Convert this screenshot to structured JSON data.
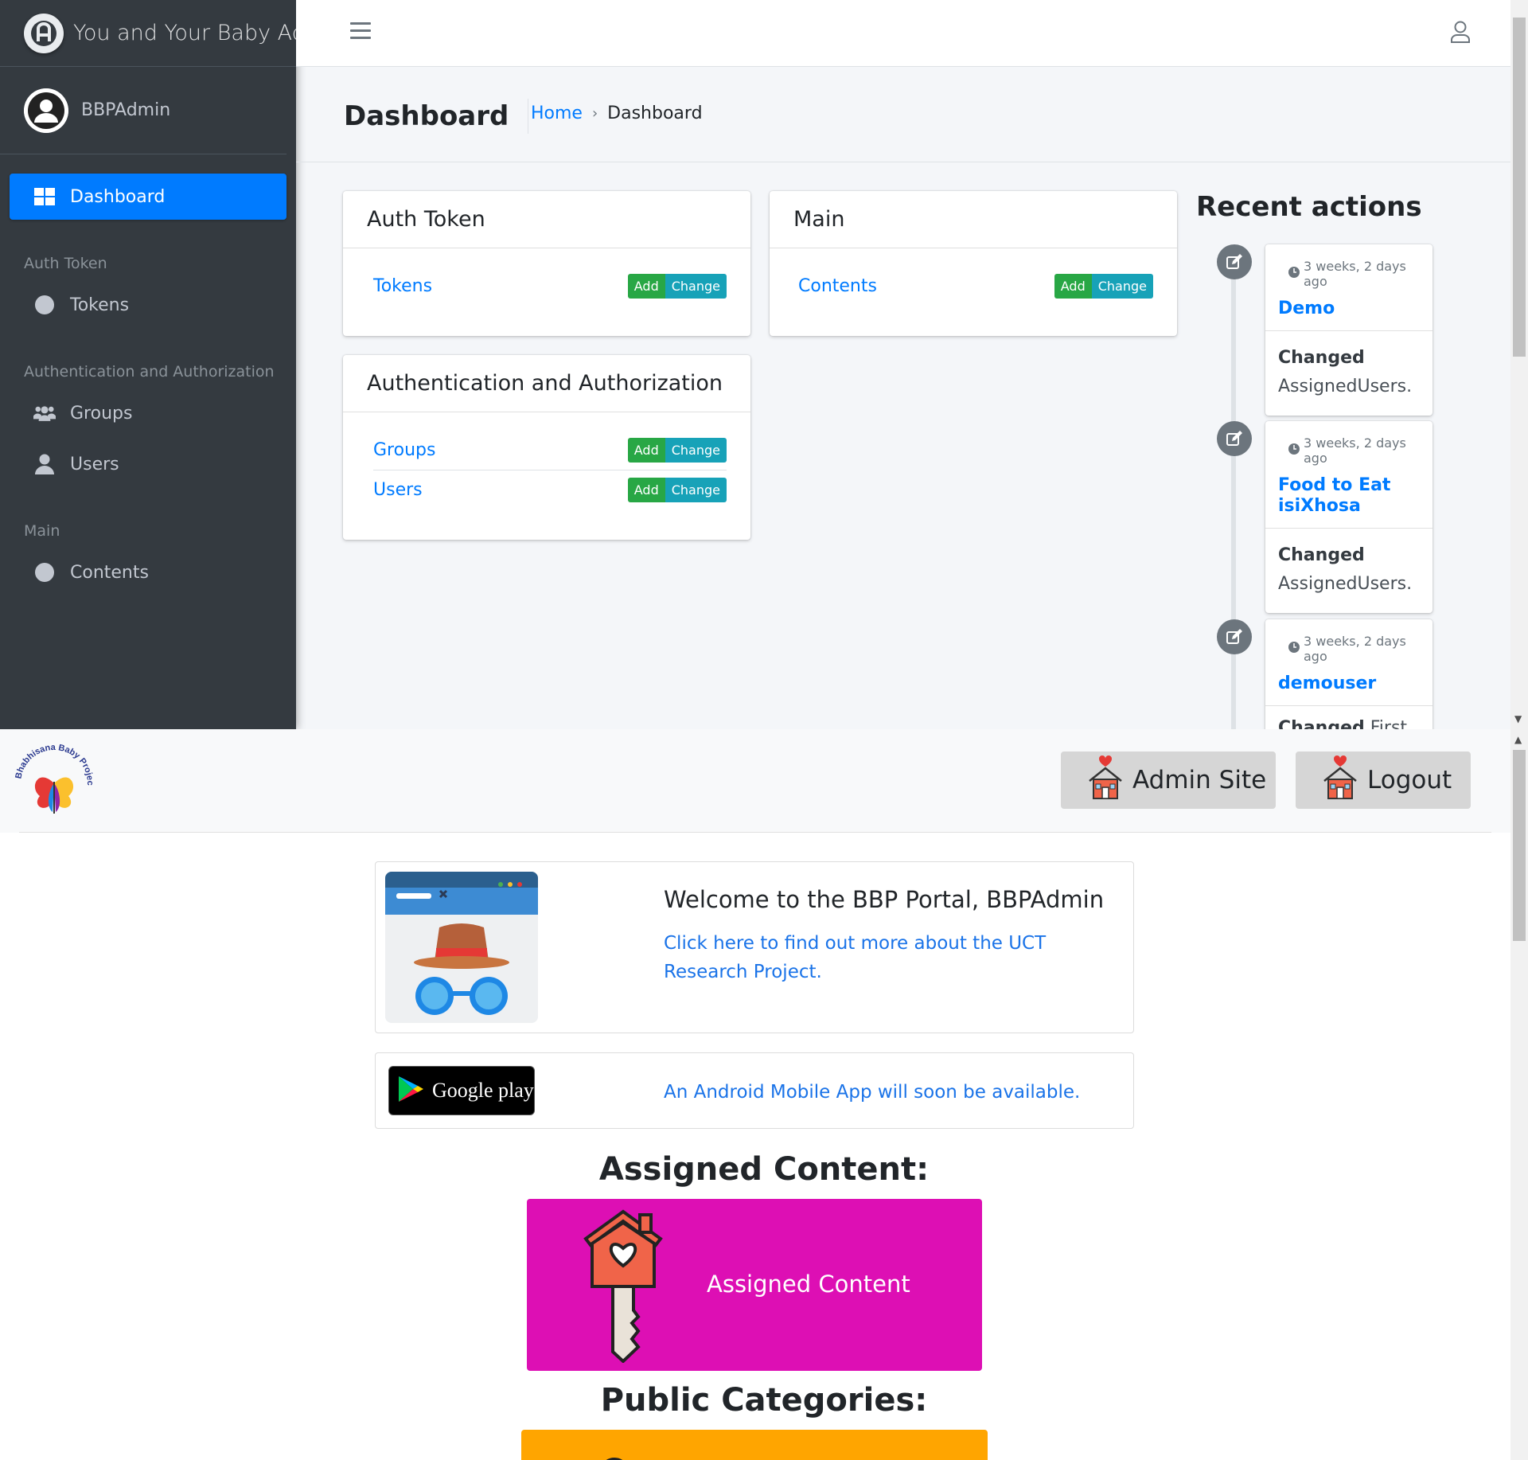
{
  "admin": {
    "brand": {
      "title": "You and Your Baby Admin"
    },
    "user": {
      "name": "BBPAdmin"
    },
    "sidebar": {
      "items": [
        {
          "label": "Dashboard",
          "icon": "dashboard-grid-icon",
          "active": true
        }
      ],
      "sections": [
        {
          "header": "Auth Token",
          "items": [
            {
              "label": "Tokens",
              "icon": "circle-icon"
            }
          ]
        },
        {
          "header": "Authentication and Authorization",
          "items": [
            {
              "label": "Groups",
              "icon": "users-group-icon"
            },
            {
              "label": "Users",
              "icon": "user-icon"
            }
          ]
        },
        {
          "header": "Main",
          "items": [
            {
              "label": "Contents",
              "icon": "circle-icon"
            }
          ]
        }
      ]
    },
    "header": {
      "page_title": "Dashboard",
      "breadcrumb": {
        "home": "Home",
        "separator": "›",
        "current": "Dashboard"
      }
    },
    "buttons": {
      "add": "Add",
      "change": "Change"
    },
    "cards": {
      "auth_token": {
        "title": "Auth Token",
        "rows": [
          "Tokens"
        ]
      },
      "main": {
        "title": "Main",
        "rows": [
          "Contents"
        ]
      },
      "auth": {
        "title": "Authentication and Authorization",
        "rows": [
          "Groups",
          "Users"
        ]
      }
    },
    "recent": {
      "title": "Recent actions",
      "items": [
        {
          "time": "3 weeks, 2 days ago",
          "object": "Demo",
          "action": "Changed",
          "detail": "AssignedUsers."
        },
        {
          "time": "3 weeks, 2 days ago",
          "object": "Food to Eat isiXhosa",
          "action": "Changed",
          "detail": "AssignedUsers."
        },
        {
          "time": "3 weeks, 2 days ago",
          "object": "demouser",
          "action": "Changed",
          "detail": "First"
        }
      ]
    }
  },
  "portal": {
    "logo_text": "Bhabhisana Baby Project",
    "header_buttons": {
      "admin_site": "Admin Site",
      "logout": "Logout"
    },
    "welcome": {
      "title": "Welcome to the BBP Portal, BBPAdmin",
      "link": "Click here to find out more about the UCT Research Project."
    },
    "android": {
      "badge": "Google play",
      "text": "An Android Mobile App will soon be available."
    },
    "assigned_title": "Assigned Content:",
    "assigned_tile": "Assigned Content",
    "public_title": "Public Categories:"
  },
  "colors": {
    "sidebar_bg": "#343a40",
    "primary": "#007bff",
    "add_green": "#28a745",
    "change_teal": "#17a2b8",
    "assigned_tile": "#dd0fb4",
    "public_tile": "#ffa500"
  }
}
